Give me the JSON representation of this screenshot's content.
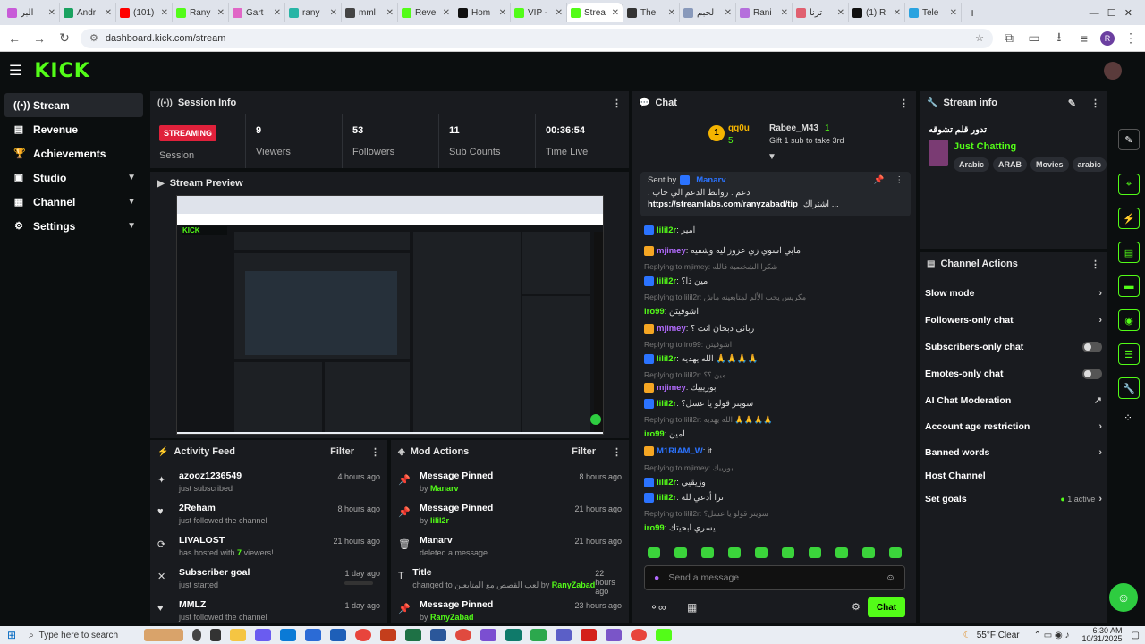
{
  "browser": {
    "tabs": [
      {
        "label": "البر",
        "color": "#c85bd8"
      },
      {
        "label": "Andr",
        "color": "#1aa260"
      },
      {
        "label": "(101)",
        "color": "#ff0000"
      },
      {
        "label": "Rany",
        "color": "#53fc18"
      },
      {
        "label": "Gart",
        "color": "#e066c6"
      },
      {
        "label": "rany",
        "color": "#28b5a6"
      },
      {
        "label": "mml",
        "color": "#444444"
      },
      {
        "label": "Reve",
        "color": "#53fc18"
      },
      {
        "label": "Hom",
        "color": "#111111"
      },
      {
        "label": "VIP -",
        "color": "#53fc18"
      },
      {
        "label": "Strea",
        "color": "#53fc18",
        "active": true
      },
      {
        "label": "The",
        "color": "#333333"
      },
      {
        "label": "لحبم",
        "color": "#8899bb"
      },
      {
        "label": "Rani",
        "color": "#b56fdc"
      },
      {
        "label": "ترنا",
        "color": "#e06070"
      },
      {
        "label": "(1) R",
        "color": "#111111"
      },
      {
        "label": "Tele",
        "color": "#2aa3e0"
      }
    ],
    "url": "dashboard.kick.com/stream",
    "profile_initial": "R"
  },
  "brand": {
    "logo": "KICK",
    "accent": "#53fc18"
  },
  "sidebar": {
    "items": [
      {
        "label": "Stream",
        "icon": "broadcast-icon"
      },
      {
        "label": "Revenue",
        "icon": "revenue-icon"
      },
      {
        "label": "Achievements",
        "icon": "trophy-icon"
      },
      {
        "label": "Studio",
        "icon": "studio-icon"
      },
      {
        "label": "Channel",
        "icon": "channel-icon"
      },
      {
        "label": "Settings",
        "icon": "gear-icon"
      }
    ]
  },
  "session": {
    "title": "Session Info",
    "status": "STREAMING",
    "status_label": "Session",
    "stats": [
      {
        "value": "9",
        "label": "Viewers"
      },
      {
        "value": "53",
        "label": "Followers"
      },
      {
        "value": "11",
        "label": "Sub Counts"
      },
      {
        "value": "00:36:54",
        "label": "Time Live"
      }
    ]
  },
  "preview": {
    "title": "Stream Preview"
  },
  "activity": {
    "title": "Activity Feed",
    "filter": "Filter",
    "items": [
      {
        "name": "azooz1236549",
        "desc": "just subscribed",
        "ago": "4 hours ago"
      },
      {
        "name": "2Reham",
        "desc": "just followed the channel",
        "ago": "8 hours ago"
      },
      {
        "name": "LIVALOST",
        "desc_pre": "has hosted with ",
        "desc_num": "7",
        "desc_post": " viewers!",
        "ago": "21 hours ago"
      },
      {
        "name": "Subscriber goal",
        "desc": "just started",
        "ago": "1 day ago"
      },
      {
        "name": "MMLZ",
        "desc": "just followed the channel",
        "ago": "1 day ago"
      }
    ]
  },
  "mod": {
    "title": "Mod Actions",
    "filter": "Filter",
    "items": [
      {
        "name": "Message Pinned",
        "desc_pre": "by ",
        "user": "Manarv",
        "ago": "8 hours ago"
      },
      {
        "name": "Message Pinned",
        "desc_pre": "by ",
        "user": "lilil2r",
        "ago": "21 hours ago"
      },
      {
        "name": "Manarv",
        "desc_pre": "deleted a message",
        "user": "",
        "ago": "21 hours ago"
      },
      {
        "name": "Title",
        "desc_pre": "changed to لعب القصص مع المتابعين by ",
        "user": "RanyZabad",
        "ago": "22 hours ago"
      },
      {
        "name": "Message Pinned",
        "desc_pre": "by ",
        "user": "RanyZabad",
        "ago": "23 hours ago"
      }
    ]
  },
  "chat": {
    "title": "Chat",
    "top": {
      "user1": "qq0u",
      "count1": "5",
      "user2": "Rabee_M43",
      "count2": "1",
      "gift": "Gift 1 sub to take 3rd"
    },
    "pinned": {
      "sent_by": "Sent by",
      "user": "Manarv",
      "line1": "دعم : روابط الدعم الي حاب :",
      "link": "https://streamlabs.com/ranyzabad/tip",
      "line2": "اشتراك ..."
    },
    "messages": [
      {
        "u": "lilil2r",
        "c": "#53fc18",
        "t": "امير",
        "type": "v"
      },
      {
        "u": "mjimey",
        "c": "#b36bff",
        "t": "مابي اسوي زي عزوز ليه وشفيه",
        "type": "c"
      },
      {
        "u": "",
        "c": "",
        "t": "Replying to mjimey: شكرا الشخصية فالله",
        "type": "r"
      },
      {
        "u": "lilil2r",
        "c": "#53fc18",
        "t": "مين ذا؟",
        "type": "v"
      },
      {
        "u": "",
        "c": "",
        "t": "Replying to lilil2r: مكريس يحب الألم لمتابعينه ماش",
        "type": "r"
      },
      {
        "u": "iro99",
        "c": "#53fc18",
        "t": "اشوفيتن",
        "type": "n"
      },
      {
        "u": "mjimey",
        "c": "#b36bff",
        "t": "ربانى ذبحان انت ؟",
        "type": "c"
      },
      {
        "u": "",
        "c": "",
        "t": "Replying to iro99: اشوفيتن",
        "type": "r"
      },
      {
        "u": "lilil2r",
        "c": "#53fc18",
        "t": "الله يهديه 🙏🙏🙏🙏",
        "type": "v"
      },
      {
        "u": "",
        "c": "",
        "t": "Replying to lilil2r: مين ؟؟",
        "type": "r"
      },
      {
        "u": "mjimey",
        "c": "#b36bff",
        "t": "بوريييك",
        "type": "c"
      },
      {
        "u": "lilil2r",
        "c": "#53fc18",
        "t": "سويتر قولو يا عسل؟",
        "type": "v"
      },
      {
        "u": "",
        "c": "",
        "t": "Replying to lilil2r: الله يهديه 🙏🙏🙏🙏",
        "type": "r"
      },
      {
        "u": "iro99",
        "c": "#53fc18",
        "t": "امين",
        "type": "n"
      },
      {
        "u": "M1RIAM_W",
        "c": "#2b73ff",
        "t": "it",
        "type": "c"
      },
      {
        "u": "",
        "c": "",
        "t": "Replying to mjimey: بورييك",
        "type": "r"
      },
      {
        "u": "lilil2r",
        "c": "#53fc18",
        "t": "وزيقيي",
        "type": "v"
      },
      {
        "u": "lilil2r",
        "c": "#53fc18",
        "t": "ترا أدعي لله",
        "type": "v"
      },
      {
        "u": "",
        "c": "",
        "t": "Replying to lilil2r: سويتر قولو يا عسل؟",
        "type": "r"
      },
      {
        "u": "iro99",
        "c": "#53fc18",
        "t": "يسري ابحيتك",
        "type": "n"
      }
    ],
    "input_placeholder": "Send a message",
    "send_label": "Chat"
  },
  "stream_info": {
    "title": "Stream info",
    "stream_title": "تدور قلم تشوقه",
    "category": "Just Chatting",
    "tags": [
      "Arabic",
      "ARAB",
      "Movies",
      "arabic"
    ]
  },
  "channel_actions": {
    "title": "Channel Actions",
    "items": [
      {
        "label": "Slow mode",
        "ctrl": "chevron"
      },
      {
        "label": "Followers-only chat",
        "ctrl": "chevron"
      },
      {
        "label": "Subscribers-only chat",
        "ctrl": "toggle"
      },
      {
        "label": "Emotes-only chat",
        "ctrl": "toggle"
      },
      {
        "label": "AI Chat Moderation",
        "ctrl": "chart"
      },
      {
        "label": "Account age restriction",
        "ctrl": "chevron"
      },
      {
        "label": "Banned words",
        "ctrl": "chevron"
      },
      {
        "label": "Host Channel",
        "ctrl": "none"
      },
      {
        "label": "Set goals",
        "ctrl": "goals",
        "extra": "1 active"
      }
    ]
  },
  "taskbar": {
    "search_placeholder": "Type here to search",
    "weather": "55°F  Clear",
    "time": "6:30 AM",
    "date": "10/31/2025"
  }
}
